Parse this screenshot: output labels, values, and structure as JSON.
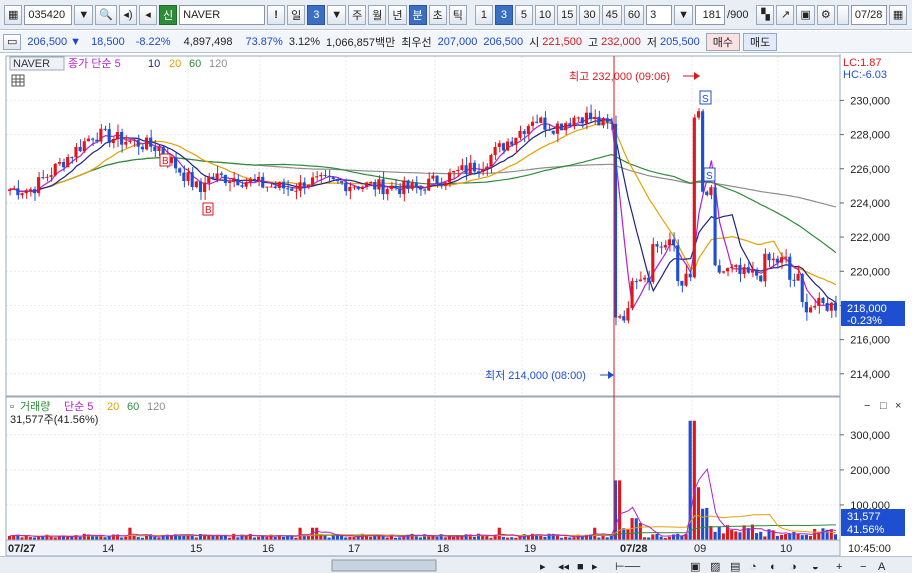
{
  "toolbar": {
    "code": "035420",
    "badge": "신",
    "stock_name": "NAVER",
    "alert": "!",
    "period_label": "일",
    "period_value": "3",
    "periods": [
      "주",
      "월",
      "년"
    ],
    "minute_label": "분",
    "tick_labels": [
      "초",
      "틱"
    ],
    "intervals": [
      "1",
      "3",
      "5",
      "10",
      "15",
      "30",
      "45",
      "60"
    ],
    "active_interval": "3",
    "count_value": "3",
    "bar_count": "181",
    "bar_total": "/900",
    "date_value": "07/28"
  },
  "quote": {
    "price": "206,500",
    "change_arrow": "▼",
    "change": "18,500",
    "change_pct": "-8.22%",
    "volume": "4,897,498",
    "vol_ratio": "73.87%",
    "turnover": "3.12%",
    "amount": "1,066,857백만",
    "best_label": "최우선",
    "best_ask": "207,000",
    "best_bid": "206,500",
    "open_label": "시",
    "open": "221,500",
    "high_label": "고",
    "high": "232,000",
    "low_label": "저",
    "low": "205,500",
    "buy_button": "매수",
    "sell_button": "매도"
  },
  "price_panel": {
    "legend_name": "NAVER",
    "legend_ma_label": "종가 단순 5",
    "ma_periods": [
      "10",
      "20",
      "60",
      "120"
    ],
    "lc": "LC:1.87",
    "hc": "HC:-6.03",
    "high_annotation": "최고 232,000 (09:06)",
    "low_annotation": "최저 214,000 (08:00)",
    "last_price": "218,000",
    "last_change": "-0.23%"
  },
  "volume_panel": {
    "legend_name": "거래량",
    "legend_ma_label": "단순 5",
    "ma_periods": [
      "20",
      "60",
      "120"
    ],
    "current_volume": "31,577주(41.56%)",
    "last_volume": "31,577",
    "last_pct": "41.56%"
  },
  "x_axis": {
    "date_labels": [
      "07/27",
      "14",
      "15",
      "16",
      "17",
      "18",
      "19",
      "07/28",
      "09",
      "10"
    ],
    "time": "10:45:00"
  },
  "chart_data": {
    "type": "candlestick",
    "price_axis": {
      "ticks": [
        "214,000",
        "216,000",
        "218,000",
        "220,000",
        "222,000",
        "224,000",
        "226,000",
        "228,000",
        "230,000"
      ],
      "ylim": [
        212700,
        232600
      ]
    },
    "volume_axis": {
      "ticks": [
        "100,000",
        "200,000",
        "300,000"
      ],
      "ylim": [
        0,
        345000
      ]
    },
    "colors": {
      "up": "#e0161d",
      "down": "#1f4fd1",
      "ma5": "#b61fd0",
      "ma10": "#1a237e",
      "ma20": "#e6a000",
      "ma60": "#2e8b3a",
      "ma120": "#8e8e8e"
    }
  }
}
